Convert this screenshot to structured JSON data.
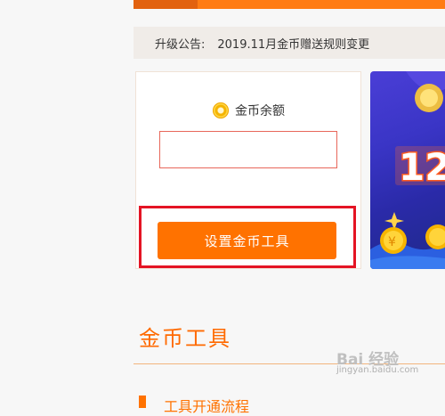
{
  "notice": {
    "label": "升级公告:",
    "text": "2019.11月金币赠送规则变更"
  },
  "coin_card": {
    "balance_label": "金币余额",
    "balance_value": "",
    "setup_button_label": "设置金币工具"
  },
  "banner": {
    "visible_text": "12"
  },
  "section": {
    "title": "金币工具",
    "first_item": "工具开通流程"
  },
  "watermark": {
    "logo": "Bai 经验",
    "url": "jingyan.baidu.com"
  },
  "colors": {
    "accent": "#ff7200",
    "highlight_frame": "#e41424",
    "input_border": "#e8675a"
  }
}
